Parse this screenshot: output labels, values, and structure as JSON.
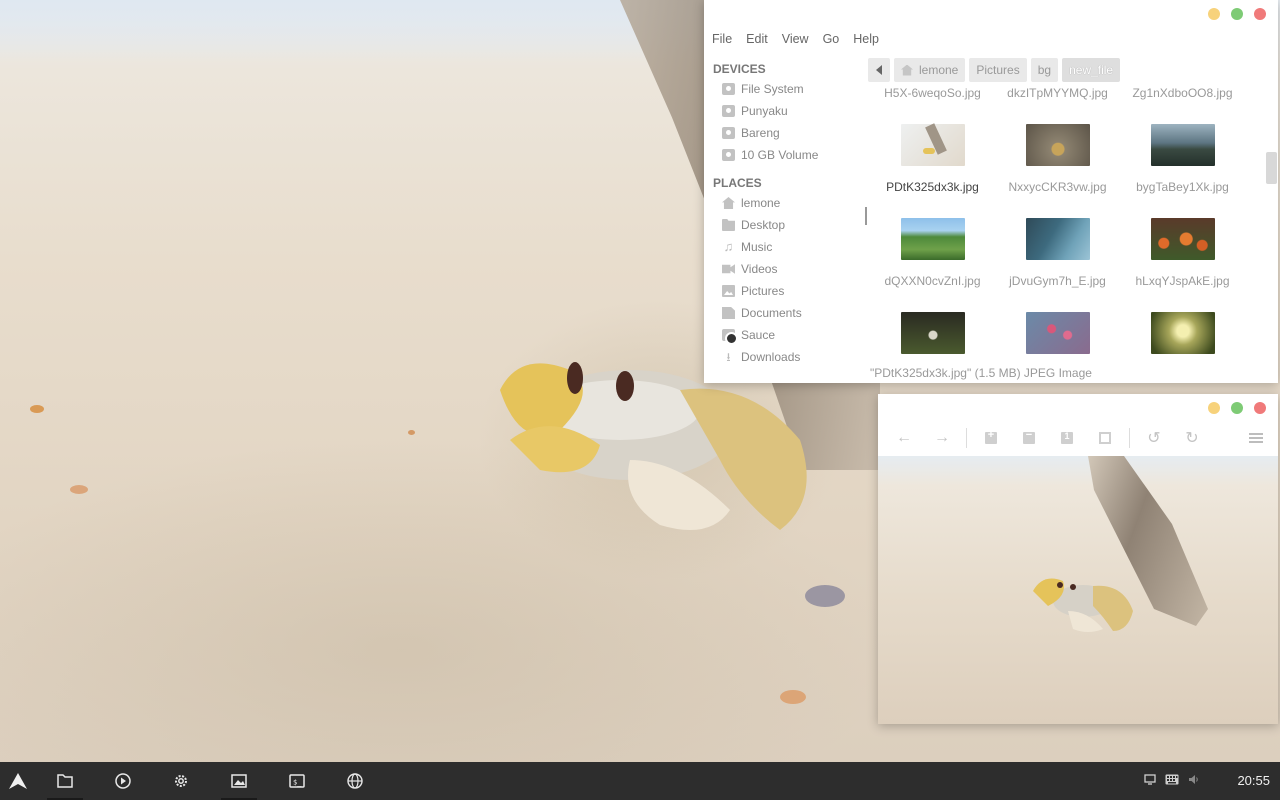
{
  "file_manager": {
    "menu": [
      "File",
      "Edit",
      "View",
      "Go",
      "Help"
    ],
    "sidebar": {
      "devices_heading": "DEVICES",
      "devices": [
        {
          "label": "File System",
          "icon": "drive-icon"
        },
        {
          "label": "Punyaku",
          "icon": "drive-icon"
        },
        {
          "label": "Bareng",
          "icon": "drive-icon"
        },
        {
          "label": "10 GB Volume",
          "icon": "drive-icon"
        }
      ],
      "places_heading": "PLACES",
      "places": [
        {
          "label": "lemone",
          "icon": "home-icon"
        },
        {
          "label": "Desktop",
          "icon": "folder-icon"
        },
        {
          "label": "Music",
          "icon": "music-icon"
        },
        {
          "label": "Videos",
          "icon": "video-icon"
        },
        {
          "label": "Pictures",
          "icon": "pictures-icon"
        },
        {
          "label": "Documents",
          "icon": "document-icon"
        },
        {
          "label": "Sauce",
          "icon": "drive-icon"
        },
        {
          "label": "Downloads",
          "icon": "download-icon"
        }
      ]
    },
    "path": [
      "lemone",
      "Pictures",
      "bg",
      "new_file"
    ],
    "top_row_names": [
      "H5X-6weqoSo.jpg",
      "dkzITpMYYMQ.jpg",
      "Zg1nXdboOO8.jpg"
    ],
    "files": [
      {
        "name": "PDtK325dx3k.jpg",
        "selected": true
      },
      {
        "name": "NxxycCKR3vw.jpg",
        "selected": false
      },
      {
        "name": "bygTaBey1Xk.jpg",
        "selected": false
      },
      {
        "name": "dQXXN0cvZnI.jpg",
        "selected": false
      },
      {
        "name": "jDvuGym7h_E.jpg",
        "selected": false
      },
      {
        "name": "hLxqYJspAkE.jpg",
        "selected": false
      },
      {
        "name": "",
        "selected": false
      },
      {
        "name": "",
        "selected": false
      },
      {
        "name": "",
        "selected": false
      }
    ],
    "status": "\"PDtK325dx3k.jpg\" (1.5 MB) JPEG Image"
  },
  "image_viewer": {
    "toolbar": [
      "back-icon",
      "forward-icon",
      "zoom-in-icon",
      "zoom-out-icon",
      "zoom-normal-icon",
      "fit-window-icon",
      "rotate-left-icon",
      "rotate-right-icon",
      "menu-icon"
    ]
  },
  "taskbar": {
    "apps": [
      "launcher-icon",
      "files-icon",
      "media-player-icon",
      "settings-icon",
      "image-viewer-icon",
      "terminal-icon",
      "browser-icon"
    ],
    "tray": [
      "display-icon",
      "keyboard-icon",
      "volume-icon"
    ],
    "clock": "20:55"
  },
  "colors": {
    "taskbar": "#2d2d2d",
    "close": "#f07a7a",
    "maximize": "#7ecb75",
    "minimize": "#f7d27b"
  }
}
